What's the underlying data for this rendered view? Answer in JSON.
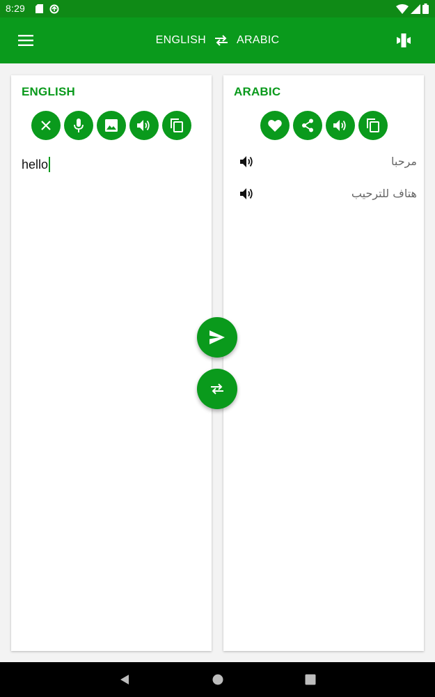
{
  "status_bar": {
    "time": "8:29",
    "icons": [
      "sd-card-icon",
      "data-saver-icon",
      "wifi-icon",
      "cellular-icon",
      "battery-icon"
    ]
  },
  "app_bar": {
    "source_language": "ENGLISH",
    "target_language": "ARABIC",
    "icons": {
      "menu": "menu-icon",
      "swap": "swap-horiz-icon",
      "mode": "conversation-mode-icon"
    }
  },
  "source_panel": {
    "title": "ENGLISH",
    "input_text": "hello",
    "actions": [
      "clear-icon",
      "mic-icon",
      "image-icon",
      "volume-icon",
      "copy-icon"
    ]
  },
  "target_panel": {
    "title": "ARABIC",
    "actions": [
      "favorite-icon",
      "share-icon",
      "volume-icon",
      "copy-icon"
    ],
    "results": [
      {
        "text": "مرحبا"
      },
      {
        "text": "هتاف للترحيب"
      }
    ]
  },
  "fabs": [
    "send-icon",
    "swap-icon"
  ],
  "nav_bar": [
    "back-icon",
    "home-icon",
    "recents-icon"
  ],
  "colors": {
    "primary": "#0a9a1c",
    "status_bar": "#0f8a16",
    "result_text": "#666666"
  }
}
